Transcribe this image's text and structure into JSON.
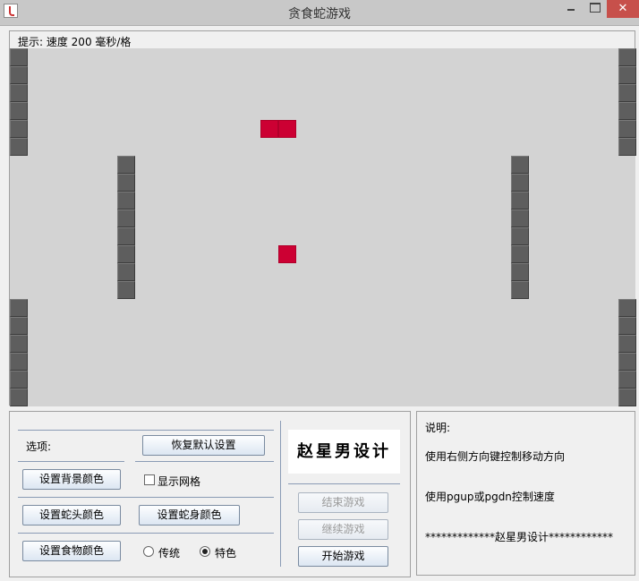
{
  "window": {
    "title": "贪食蛇游戏",
    "close_glyph": "✕"
  },
  "hint": "提示: 速度 200 毫秒/格",
  "game": {
    "background": "#d3d3d3",
    "wall_color": "#5e5e5e",
    "snake_color": "#cc0033",
    "food_color": "#cc0033"
  },
  "options": {
    "title": "选项:",
    "restore_defaults": "恢复默认设置",
    "set_bg_color": "设置背景颜色",
    "show_grid": "显示网格",
    "set_head_color": "设置蛇头颜色",
    "set_body_color": "设置蛇身颜色",
    "set_food_color": "设置食物颜色",
    "mode_traditional": "传统",
    "mode_special": "特色",
    "selected_mode": "特色",
    "show_grid_checked": false
  },
  "logo_text": "赵星男设计",
  "controls": {
    "end_game": "结束游戏",
    "continue_game": "继续游戏",
    "start_game": "开始游戏"
  },
  "description": {
    "title": "说明:",
    "line1": "使用右侧方向键控制移动方向",
    "line2": "使用pgup或pgdn控制速度",
    "line3": "*************赵星男设计************"
  }
}
